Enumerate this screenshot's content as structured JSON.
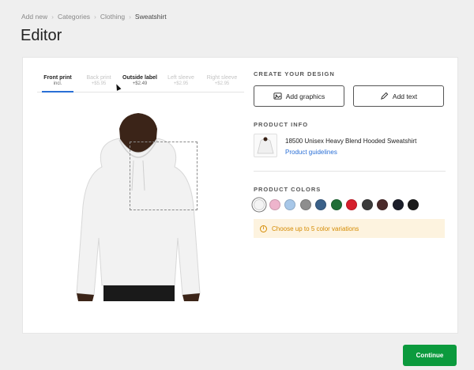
{
  "breadcrumb": {
    "items": [
      "Add new",
      "Categories",
      "Clothing",
      "Sweatshirt"
    ]
  },
  "page_title": "Editor",
  "tabs": [
    {
      "label": "Front print",
      "price": "incl."
    },
    {
      "label": "Back print",
      "price": "+$5.95"
    },
    {
      "label": "Outside label",
      "price": "+$2.49"
    },
    {
      "label": "Left sleeve",
      "price": "+$2.95"
    },
    {
      "label": "Right sleeve",
      "price": "+$2.95"
    }
  ],
  "create_design": {
    "heading": "CREATE YOUR DESIGN",
    "add_graphics_label": "Add graphics",
    "add_text_label": "Add text"
  },
  "product_info": {
    "heading": "PRODUCT INFO",
    "name": "18500 Unisex Heavy Blend Hooded Sweatshirt",
    "guidelines_link": "Product guidelines"
  },
  "product_colors": {
    "heading": "PRODUCT COLORS",
    "swatches": [
      "#f4f4f4",
      "#eeb4cc",
      "#a7c7e8",
      "#8e8e8e",
      "#3a6189",
      "#1f6e36",
      "#d61f2c",
      "#3b3b3b",
      "#4a2a2a",
      "#1c1f2a",
      "#1a1a1a"
    ],
    "notice": "Choose up to 5 color variations"
  },
  "continue_label": "Continue"
}
